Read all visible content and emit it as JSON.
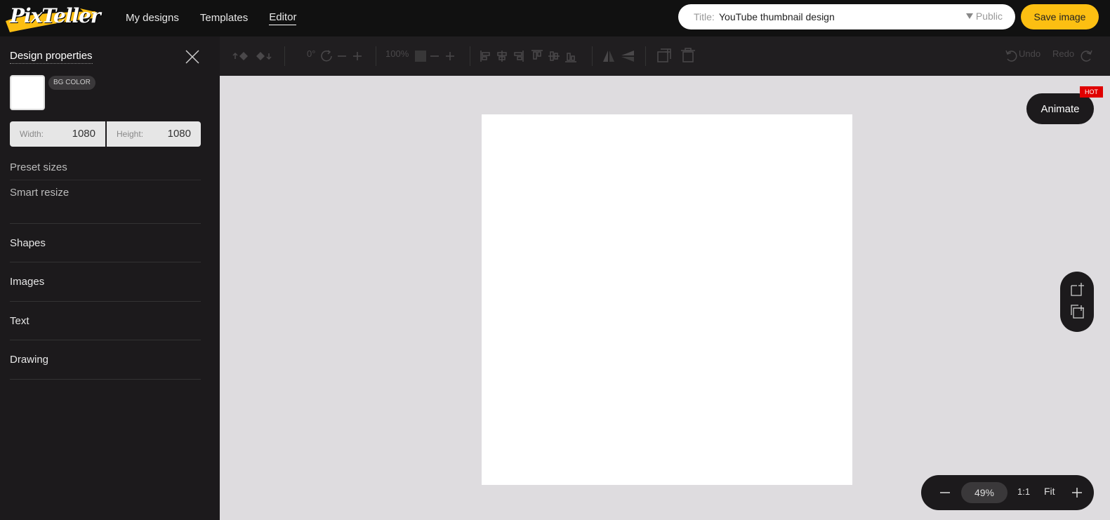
{
  "header": {
    "logo_text": "PixTeller",
    "nav": [
      {
        "label": "My designs"
      },
      {
        "label": "Templates"
      },
      {
        "label": "Editor",
        "active": true
      }
    ],
    "title_label": "Title:",
    "title_value": "YouTube thumbnail design",
    "visibility": "Public",
    "save_label": "Save image",
    "accent_color": "#fcbf12"
  },
  "sidebar": {
    "heading": "Design properties",
    "bg_color_label": "BG COLOR",
    "bg_color": "#ffffff",
    "width_label": "Width:",
    "width_value": "1080",
    "height_label": "Height:",
    "height_value": "1080",
    "links": [
      {
        "label": "Preset sizes"
      },
      {
        "label": "Smart resize"
      }
    ],
    "sections": [
      {
        "label": "Shapes"
      },
      {
        "label": "Images"
      },
      {
        "label": "Text"
      },
      {
        "label": "Drawing"
      }
    ]
  },
  "toolbar": {
    "rotation": "0°",
    "opacity": "100%",
    "undo_label": "Undo",
    "redo_label": "Redo"
  },
  "canvas_area": {
    "animate_label": "Animate",
    "hot_badge": "HOT",
    "zoom_value": "49%",
    "zoom_actual": "1:1",
    "zoom_fit": "Fit"
  }
}
